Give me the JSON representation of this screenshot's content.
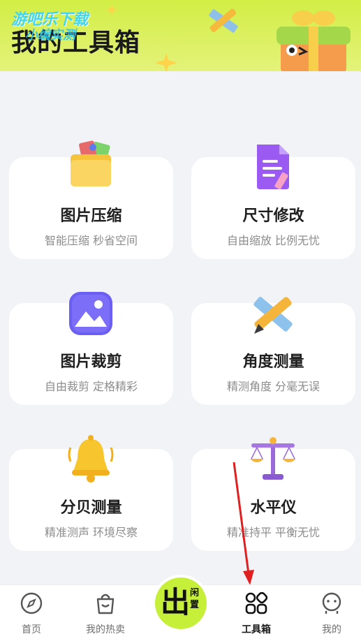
{
  "header": {
    "title": "我的工具箱",
    "watermark_line1": "游吧乐下载",
    "watermark_line2": "小编实测"
  },
  "tools": [
    {
      "title": "图片压缩",
      "subtitle": "智能压缩 秒省空间",
      "icon": "folder-icon"
    },
    {
      "title": "尺寸修改",
      "subtitle": "自由缩放 比例无忧",
      "icon": "document-edit-icon"
    },
    {
      "title": "图片裁剪",
      "subtitle": "自由裁剪 定格精彩",
      "icon": "image-icon"
    },
    {
      "title": "角度测量",
      "subtitle": "精测角度 分毫无误",
      "icon": "ruler-pencil-icon"
    },
    {
      "title": "分贝测量",
      "subtitle": "精准测声 环境尽察",
      "icon": "bell-icon"
    },
    {
      "title": "水平仪",
      "subtitle": "精准持平 平衡无忧",
      "icon": "balance-scale-icon"
    }
  ],
  "tabbar": {
    "items": [
      {
        "label": "首页",
        "icon": "compass-icon",
        "active": false
      },
      {
        "label": "我的热卖",
        "icon": "shopping-bag-icon",
        "active": false
      },
      {
        "label": "工具箱",
        "icon": "grid-icon",
        "active": true
      },
      {
        "label": "我的",
        "icon": "profile-icon",
        "active": false
      }
    ],
    "center": {
      "big": "出",
      "small": "闲置"
    }
  },
  "colors": {
    "header_green": "#d2ee45",
    "center_button": "#c6ef3a",
    "annotation_arrow": "#e02020"
  }
}
